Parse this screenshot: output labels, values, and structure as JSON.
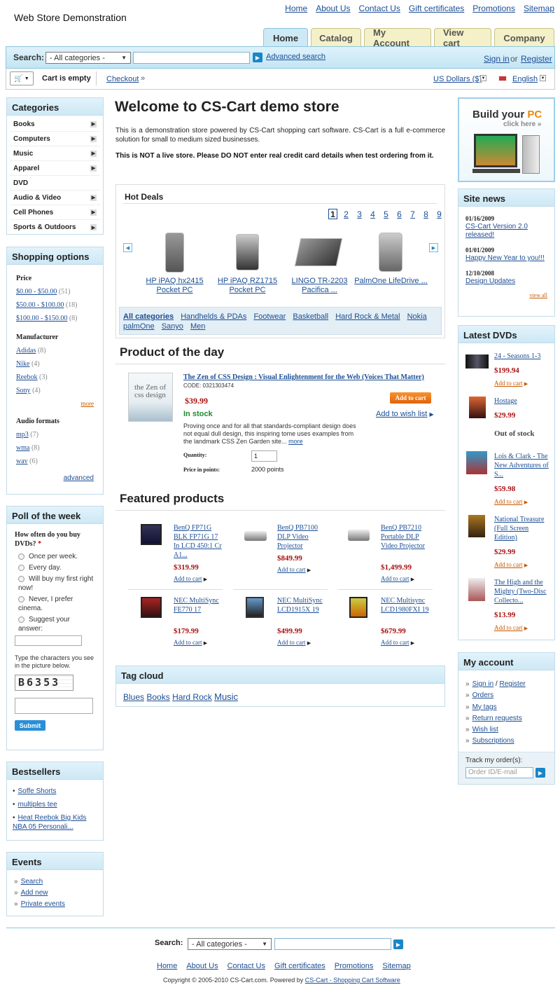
{
  "store_title": "Web Store Demonstration",
  "top_links": [
    "Home",
    "About Us",
    "Contact Us",
    "Gift certificates",
    "Promotions",
    "Sitemap"
  ],
  "tabs": [
    "Home",
    "Catalog",
    "My Account",
    "View cart",
    "Company"
  ],
  "search": {
    "label": "Search:",
    "category": "- All categories -",
    "advanced": "Advanced search",
    "sign_in": "Sign in",
    "or": "or",
    "register": "Register"
  },
  "cart": {
    "status": "Cart is empty",
    "checkout": "Checkout",
    "currency": "US Dollars ($)",
    "language": "English"
  },
  "categories": {
    "title": "Categories",
    "items": [
      "Books",
      "Computers",
      "Music",
      "Apparel",
      "DVD",
      "Audio & Video",
      "Cell Phones",
      "Sports & Outdoors"
    ]
  },
  "shopping_options": {
    "title": "Shopping options",
    "price_label": "Price",
    "prices": [
      {
        "label": "$0.00 - $50.00",
        "count": "(51)"
      },
      {
        "label": "$50.00 - $100.00",
        "count": "(18)"
      },
      {
        "label": "$100.00 - $150.00",
        "count": "(8)"
      }
    ],
    "manufacturer_label": "Manufacturer",
    "manufacturers": [
      {
        "label": "Adidas",
        "count": "(8)"
      },
      {
        "label": "Nike",
        "count": "(4)"
      },
      {
        "label": "Reebok",
        "count": "(3)"
      },
      {
        "label": "Sony",
        "count": "(4)"
      }
    ],
    "more": "more",
    "audio_label": "Audio formats",
    "audio": [
      {
        "label": "mp3",
        "count": "(7)"
      },
      {
        "label": "wma",
        "count": "(8)"
      },
      {
        "label": "wav",
        "count": "(6)"
      }
    ],
    "advanced": "advanced"
  },
  "poll": {
    "title": "Poll of the week",
    "question": "How often do you buy DVDs?",
    "required": "*",
    "options": [
      "Once per week.",
      "Every day.",
      "Will buy my first right now!",
      "Never, I prefer cinema.",
      "Suggest your answer:"
    ],
    "captcha_prompt": "Type the characters you see in the picture below.",
    "captcha": "B6353",
    "submit": "Submit"
  },
  "bestsellers": {
    "title": "Bestsellers",
    "items": [
      "Soffe Shorts",
      "multiples tee",
      "Heat Reebok Big Kids NBA 05 Personali..."
    ]
  },
  "events": {
    "title": "Events",
    "items": [
      "Search",
      "Add new",
      "Private events"
    ]
  },
  "welcome": {
    "title": "Welcome to CS-Cart demo store",
    "text": "This is a demonstration store powered by CS-Cart shopping cart software. CS-Cart is a full e-commerce solution for small to medium sized businesses.",
    "warning": "This is NOT a live store. Please DO NOT enter real credit card details when test ordering from it."
  },
  "hot_deals": {
    "title": "Hot Deals",
    "pages": [
      "1",
      "2",
      "3",
      "4",
      "5",
      "6",
      "7",
      "8",
      "9"
    ],
    "products": [
      {
        "name": "HP iPAQ hx2415 Pocket PC"
      },
      {
        "name": "HP iPAQ RZ1715 Pocket PC"
      },
      {
        "name": "LINGO TR-2203 Pacifica ..."
      },
      {
        "name": "PalmOne LifeDrive ..."
      }
    ],
    "categories": [
      "All categories",
      "Handhelds & PDAs",
      "Footwear",
      "Basketball",
      "Hard Rock & Metal",
      "Nokia",
      "palmOne",
      "Sanyo",
      "Men"
    ]
  },
  "product_of_day": {
    "title": "Product of the day",
    "name": "The Zen of CSS Design : Visual Enlightenment for the Web (Voices That Matter)",
    "code": "CODE: 0321303474",
    "price": "$39.99",
    "stock": "In stock",
    "add_to_cart": "Add to cart",
    "wishlist": "Add to wish list",
    "desc": "Proving once and for all that standards-compliant design does not equal dull design, this inspiring tome uses examples from the landmark CSS Zen Garden site...",
    "more": "more",
    "qty_label": "Quantity:",
    "qty": "1",
    "points_label": "Price in points:",
    "points": "2000 points",
    "img_text": "the Zen of css design"
  },
  "featured": {
    "title": "Featured products",
    "add_to_cart": "Add to cart",
    "items": [
      {
        "name": "BenQ FP71G BLK FP71G 17 In LCD 450:1 Cr A1...",
        "price": "$319.99"
      },
      {
        "name": "BenQ PB7100 DLP Video Projector",
        "price": "$849.99"
      },
      {
        "name": "BenQ PB7210 Portable DLP Video Projector",
        "price": "$1,499.99"
      },
      {
        "name": "NEC MultiSync FE770 17",
        "price": "$179.99"
      },
      {
        "name": "NEC MultiSync LCD1915X 19",
        "price": "$499.99"
      },
      {
        "name": "NEC Multisync LCD1980FXI 19",
        "price": "$679.99"
      }
    ]
  },
  "tag_cloud": {
    "title": "Tag cloud",
    "tags": [
      "Blues",
      "Books",
      "Hard Rock",
      "Music"
    ]
  },
  "banner": {
    "title_a": "Build your ",
    "title_b": "PC",
    "sub": "click here »"
  },
  "site_news": {
    "title": "Site news",
    "items": [
      {
        "date": "01/16/2009",
        "text": "CS-Cart Version 2.0 released!"
      },
      {
        "date": "01/01/2009",
        "text": "Happy New Year to you!!!"
      },
      {
        "date": "12/10/2008",
        "text": "Design Updates"
      }
    ],
    "view_all": "view all"
  },
  "latest_dvds": {
    "title": "Latest DVDs",
    "add_to_cart": "Add to cart",
    "items": [
      {
        "name": "24 - Seasons 1-3",
        "price": "$199.94",
        "status": ""
      },
      {
        "name": "Hostage",
        "price": "$29.99",
        "status": "Out of stock"
      },
      {
        "name": "Lois & Clark - The New Adventures of S...",
        "price": "$59.98",
        "status": ""
      },
      {
        "name": "National Treasure (Full Screen Edition)",
        "price": "$29.99",
        "status": ""
      },
      {
        "name": "The High and the Mighty (Two-Disc Collecto...",
        "price": "$13.99",
        "status": ""
      }
    ]
  },
  "my_account": {
    "title": "My account",
    "sign_in": "Sign in",
    "slash": "/",
    "register": "Register",
    "items": [
      "Orders",
      "My tags",
      "Return requests",
      "Wish list",
      "Subscriptions"
    ],
    "track_label": "Track my order(s):",
    "track_placeholder": "Order ID/E-mail"
  },
  "footer": {
    "search_label": "Search:",
    "category": "- All categories -",
    "links": [
      "Home",
      "About Us",
      "Contact Us",
      "Gift certificates",
      "Promotions",
      "Sitemap"
    ],
    "copyright": "Copyright © 2005-2010 CS-Cart.com.  Powered by",
    "powered_link": "CS-Cart - Shopping Cart Software"
  }
}
